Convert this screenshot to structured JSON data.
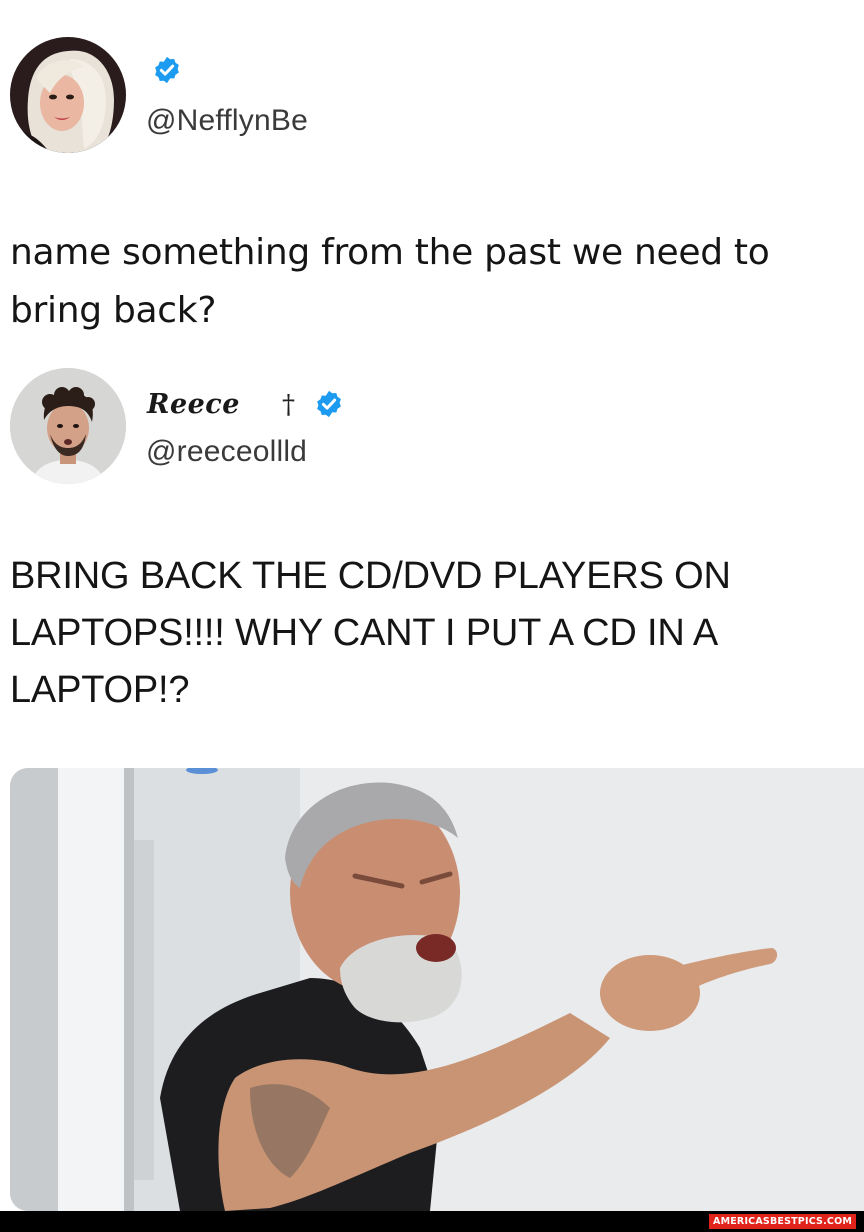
{
  "tweet_original": {
    "handle": "@NefflynBe",
    "verified": true,
    "text": "name something from the past we need to bring back?"
  },
  "tweet_reply": {
    "display_name": "Reece",
    "name_symbol": "†",
    "handle": "@reeceollld",
    "verified": true,
    "text": "BRING BACK THE CD/DVD PLAYERS ON LAPTOPS!!!! WHY CANT I PUT A CD IN A LAPTOP!?"
  },
  "media": {
    "icon": "angry-man-pointing-meme"
  },
  "footer": {
    "watermark": "AMERICASBESTPICS.COM"
  },
  "colors": {
    "verified_blue": "#1d9bf0",
    "watermark_red": "#e0241b",
    "text": "#151515",
    "handle_gray": "#3a3a3a"
  }
}
